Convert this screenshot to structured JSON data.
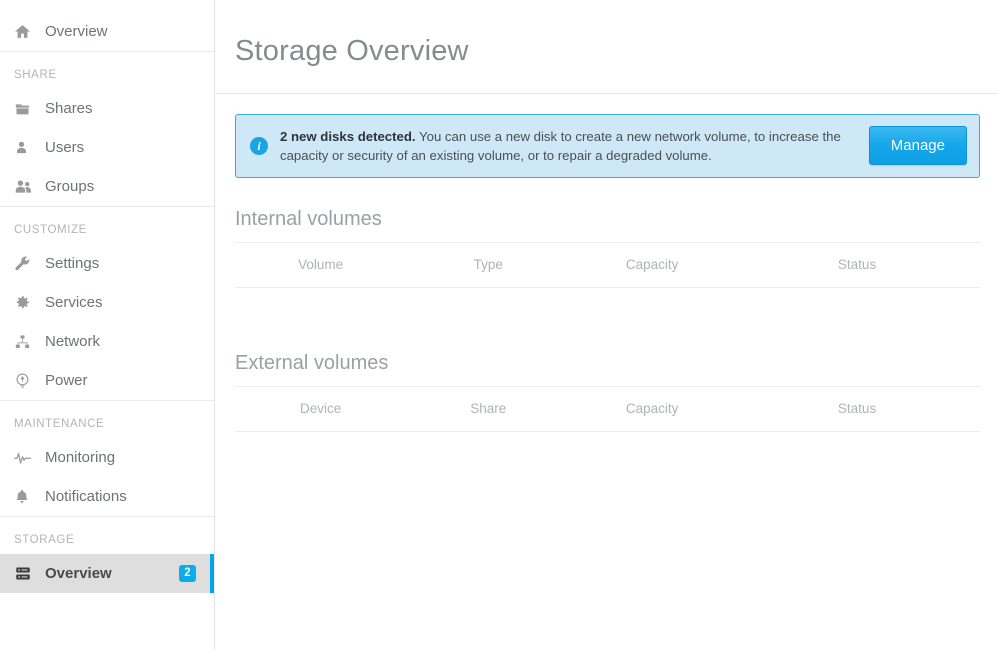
{
  "sidebar": {
    "groups": [
      {
        "title": "",
        "items": [
          {
            "label": "Overview",
            "icon": "home-icon",
            "selected": false,
            "badge": ""
          }
        ]
      },
      {
        "title": "SHARE",
        "items": [
          {
            "label": "Shares",
            "icon": "folder-icon",
            "selected": false,
            "badge": ""
          },
          {
            "label": "Users",
            "icon": "user-icon",
            "selected": false,
            "badge": ""
          },
          {
            "label": "Groups",
            "icon": "users-group-icon",
            "selected": false,
            "badge": ""
          }
        ]
      },
      {
        "title": "CUSTOMIZE",
        "items": [
          {
            "label": "Settings",
            "icon": "wrench-icon",
            "selected": false,
            "badge": ""
          },
          {
            "label": "Services",
            "icon": "gear-icon",
            "selected": false,
            "badge": ""
          },
          {
            "label": "Network",
            "icon": "network-icon",
            "selected": false,
            "badge": ""
          },
          {
            "label": "Power",
            "icon": "power-icon",
            "selected": false,
            "badge": ""
          }
        ]
      },
      {
        "title": "MAINTENANCE",
        "items": [
          {
            "label": "Monitoring",
            "icon": "pulse-icon",
            "selected": false,
            "badge": ""
          },
          {
            "label": "Notifications",
            "icon": "bell-icon",
            "selected": false,
            "badge": ""
          }
        ]
      },
      {
        "title": "STORAGE",
        "items": [
          {
            "label": "Overview",
            "icon": "storage-icon",
            "selected": true,
            "badge": "2"
          }
        ]
      }
    ]
  },
  "header": {
    "title": "Storage Overview"
  },
  "banner": {
    "icon": "info-icon",
    "strong": "2 new disks detected.",
    "message": " You can use a new disk to create a new network volume, to increase the capacity or security of an existing volume, or to repair a degraded volume.",
    "button_label": "Manage",
    "accent_color": "#0f9fe4",
    "background_color": "#cfe8f8",
    "border_color": "#3ba8e0"
  },
  "internal_volumes": {
    "title": "Internal volumes",
    "columns": [
      "Volume",
      "Type",
      "Capacity",
      "Status"
    ],
    "rows": []
  },
  "external_volumes": {
    "title": "External volumes",
    "columns": [
      "Device",
      "Share",
      "Capacity",
      "Status"
    ],
    "rows": []
  }
}
